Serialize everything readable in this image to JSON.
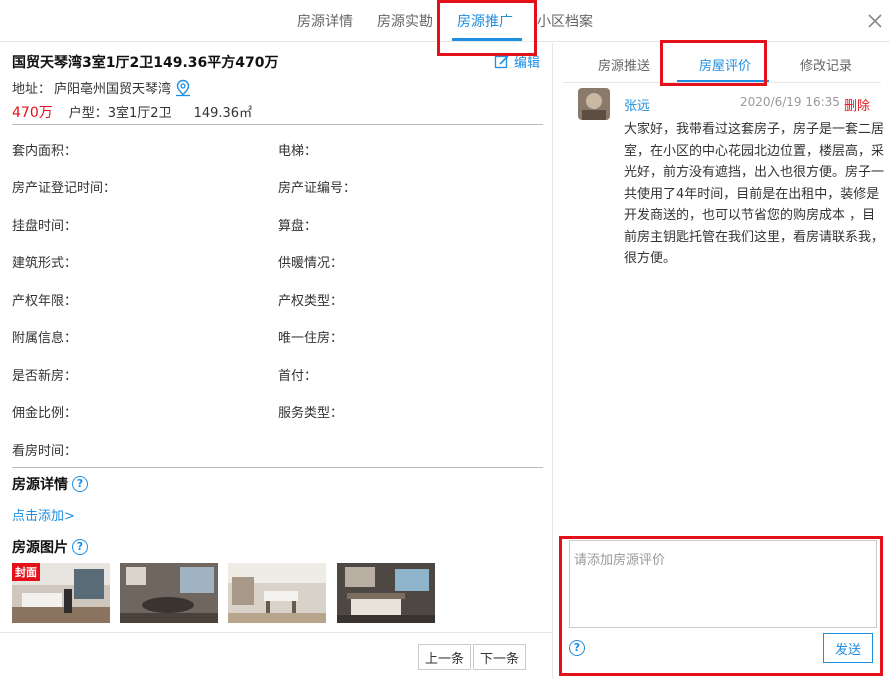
{
  "top_tabs": [
    "房源详情",
    "房源实勘",
    "房源推广",
    "小区档案"
  ],
  "house": {
    "title": "国贸天琴湾3室1厅2卫149.36平方470万",
    "edit_label": "编辑",
    "address_label": "地址：",
    "address": "庐阳亳州国贸天琴湾",
    "price": "470万",
    "layout_label": "户型：",
    "layout": "3室1厅2卫",
    "area": "149.36㎡"
  },
  "fields": [
    [
      "套内面积：",
      "电梯："
    ],
    [
      "房产证登记时间：",
      "房产证编号："
    ],
    [
      "挂盘时间：",
      "算盘："
    ],
    [
      "建筑形式：",
      "供暖情况："
    ],
    [
      "产权年限：",
      "产权类型："
    ],
    [
      "附属信息：",
      "唯一住房："
    ],
    [
      "是否新房：",
      "首付："
    ],
    [
      "佣金比例：",
      "服务类型："
    ],
    [
      "看房时间："
    ]
  ],
  "details": {
    "title": "房源详情",
    "add_link": "点击添加>"
  },
  "photos": {
    "title": "房源图片",
    "cover_badge": "封面"
  },
  "nav": {
    "prev": "上一条",
    "next": "下一条"
  },
  "sub_tabs": [
    "房源推送",
    "房屋评价",
    "修改记录"
  ],
  "comment": {
    "user": "张远",
    "time": "2020/6/19 16:35",
    "delete": "删除",
    "text": "大家好，我带看过这套房子，房子是一套二居室，在小区的中心花园北边位置，楼层高，采光好，前方没有遮挡，出入也很方便。房子一共使用了4年时间，目前是在出租中，装修是开发商送的，也可以节省您的购房成本 ，目前房主钥匙托管在我们这里，看房请联系我，很方便。"
  },
  "input": {
    "placeholder": "请添加房源评价",
    "send": "发送"
  },
  "colors": {
    "accent": "#1e8ee0",
    "danger": "#e5111a"
  }
}
